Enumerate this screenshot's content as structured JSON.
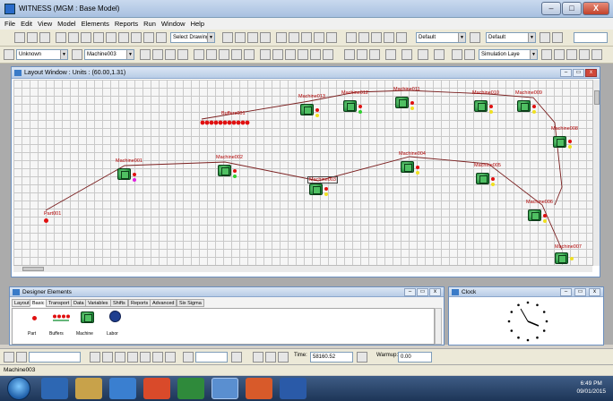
{
  "window": {
    "title": "WITNESS (MGM : Base Model)",
    "controls": [
      "–",
      "□",
      "X"
    ]
  },
  "menu": [
    "File",
    "Edit",
    "View",
    "Model",
    "Elements",
    "Reports",
    "Run",
    "Window",
    "Help"
  ],
  "toolbar1": {
    "drawing_combo": "Select Drawing",
    "default_combo_1": "Default",
    "default_combo_2": "Default"
  },
  "toolbar2": {
    "type_combo": "Unknown",
    "element_combo": "Machine003",
    "layer_combo": "Simulation Laye"
  },
  "layout_window": {
    "title": "Layout Window : Units : (60.00,1.31)",
    "buffer_label": "Buffers001",
    "part_label": "Part001",
    "machines": [
      {
        "id": "m1",
        "label": "Machine001"
      },
      {
        "id": "m2",
        "label": "Machine002"
      },
      {
        "id": "m3",
        "label": "Machine003"
      },
      {
        "id": "m4",
        "label": "Machine004"
      },
      {
        "id": "m5",
        "label": "Machine005"
      },
      {
        "id": "m6",
        "label": "Machine006"
      },
      {
        "id": "m7",
        "label": "Machine007"
      },
      {
        "id": "m8",
        "label": "Machine008"
      },
      {
        "id": "m9",
        "label": "Machine009"
      },
      {
        "id": "m10",
        "label": "Machine010"
      },
      {
        "id": "m11",
        "label": "Machine011"
      },
      {
        "id": "m12",
        "label": "Machine012"
      },
      {
        "id": "m13",
        "label": "Machine013"
      }
    ]
  },
  "designer": {
    "title": "Designer Elements",
    "tabs": [
      "Layout",
      "Basic",
      "Transport",
      "Data",
      "Variables",
      "Shifts",
      "Reports",
      "Advanced",
      "Six Sigma"
    ],
    "active_tab": "Basic",
    "palette": [
      "Part",
      "Buffers",
      "Machine",
      "Labor"
    ]
  },
  "clock_window": {
    "title": "Clock"
  },
  "runbar": {
    "time_label": "Time:",
    "time_value": "58160.52",
    "warmup_label": "Warmup:",
    "warmup_value": "0.00"
  },
  "status": {
    "text": "Machine003"
  },
  "taskbar": {
    "time": "6:49 PM",
    "date": "09/01/2015"
  },
  "colors": {
    "machine": "#2e9e48",
    "label": "#b00000",
    "path": "#7a1f1f",
    "taskbar": "#1d3557"
  }
}
